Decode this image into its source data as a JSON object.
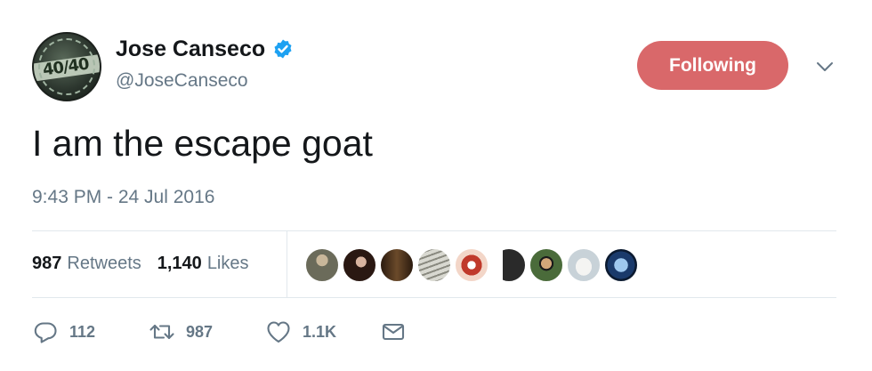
{
  "user": {
    "display_name": "Jose Canseco",
    "handle": "@JoseCanseco",
    "verified": true,
    "verified_color": "#1da1f2",
    "avatar_badge": "40/40"
  },
  "follow_button": {
    "label": "Following",
    "color": "#d9686a"
  },
  "menu": {
    "icon": "chevron-down-icon"
  },
  "tweet": {
    "text": "I am the escape goat",
    "timestamp": "9:43 PM - 24 Jul 2016"
  },
  "stats": {
    "retweets_count": "987",
    "retweets_label": "Retweets",
    "likes_count": "1,140",
    "likes_label": "Likes"
  },
  "likers": [
    {
      "icon": "liker-avatar-1",
      "color": "#6b6b5a"
    },
    {
      "icon": "liker-avatar-2",
      "color": "#4a2a22"
    },
    {
      "icon": "liker-avatar-3",
      "color": "#3a2a1a"
    },
    {
      "icon": "liker-avatar-4",
      "color": "#b9b9b0"
    },
    {
      "icon": "liker-avatar-5",
      "color": "#c0392b"
    },
    {
      "icon": "liker-avatar-6",
      "color": "#2a2a2a"
    },
    {
      "icon": "liker-avatar-7",
      "color": "#4a6b3a"
    },
    {
      "icon": "liker-avatar-8",
      "color": "#e6eef2"
    },
    {
      "icon": "liker-avatar-9",
      "color": "#1a3a6b"
    }
  ],
  "actions": {
    "reply_count": "112",
    "retweet_count": "987",
    "like_count": "1.1K",
    "reply_icon": "reply-icon",
    "retweet_icon": "retweet-icon",
    "like_icon": "heart-icon",
    "dm_icon": "envelope-icon"
  }
}
